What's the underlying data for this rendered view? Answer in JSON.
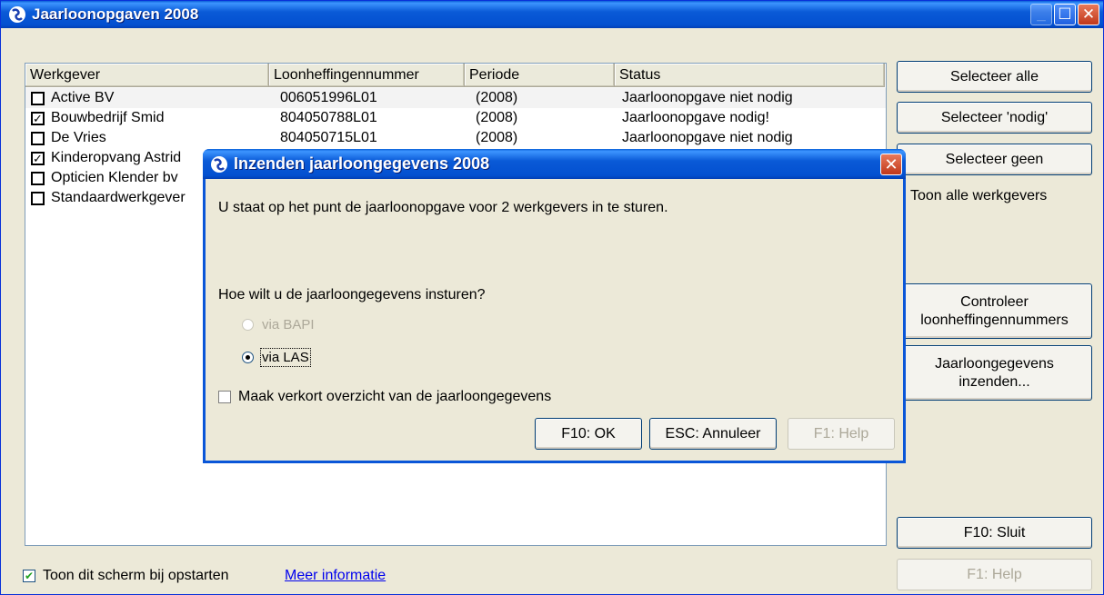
{
  "window": {
    "title": "Jaarloonopgaven 2008"
  },
  "list": {
    "columns": [
      "Werkgever",
      "Loonheffingennummer",
      "Periode",
      "Status"
    ],
    "rows": [
      {
        "checked": false,
        "werkgever": "Active BV",
        "nummer": "006051996L01",
        "periode": "(2008)",
        "status": "Jaarloonopgave niet nodig"
      },
      {
        "checked": true,
        "werkgever": "Bouwbedrijf Smid",
        "nummer": "804050788L01",
        "periode": "(2008)",
        "status": "Jaarloonopgave nodig!"
      },
      {
        "checked": false,
        "werkgever": "De Vries",
        "nummer": "804050715L01",
        "periode": "(2008)",
        "status": "Jaarloonopgave niet nodig"
      },
      {
        "checked": true,
        "werkgever": "Kinderopvang Astrid",
        "nummer": "",
        "periode": "",
        "status": ""
      },
      {
        "checked": false,
        "werkgever": "Opticien Klender bv",
        "nummer": "",
        "periode": "",
        "status": ""
      },
      {
        "checked": false,
        "werkgever": "Standaardwerkgever",
        "nummer": "",
        "periode": "",
        "status": ""
      }
    ]
  },
  "side": {
    "select_all": "Selecteer alle",
    "select_needed": "Selecteer 'nodig'",
    "select_none": "Selecteer geen",
    "show_all": "Toon alle werkgevers",
    "check_numbers": "Controleer loonheffingennummers",
    "submit": "Jaarloongegevens inzenden...",
    "close": "F10: Sluit",
    "help": "F1: Help"
  },
  "footer": {
    "startup_label": "Toon dit scherm bij opstarten",
    "more_info": "Meer informatie"
  },
  "dialog": {
    "title": "Inzenden jaarloongegevens 2008",
    "message": "U staat op het punt de jaarloonopgave voor 2 werkgevers in te sturen.",
    "question": "Hoe wilt u de jaarloongegevens insturen?",
    "option_bapi": "via BAPI",
    "option_las": "via LAS",
    "selected_option": "via LAS",
    "short_overview": "Maak verkort overzicht van de jaarloongegevens",
    "ok": "F10: OK",
    "cancel": "ESC: Annuleer",
    "help": "F1: Help"
  }
}
